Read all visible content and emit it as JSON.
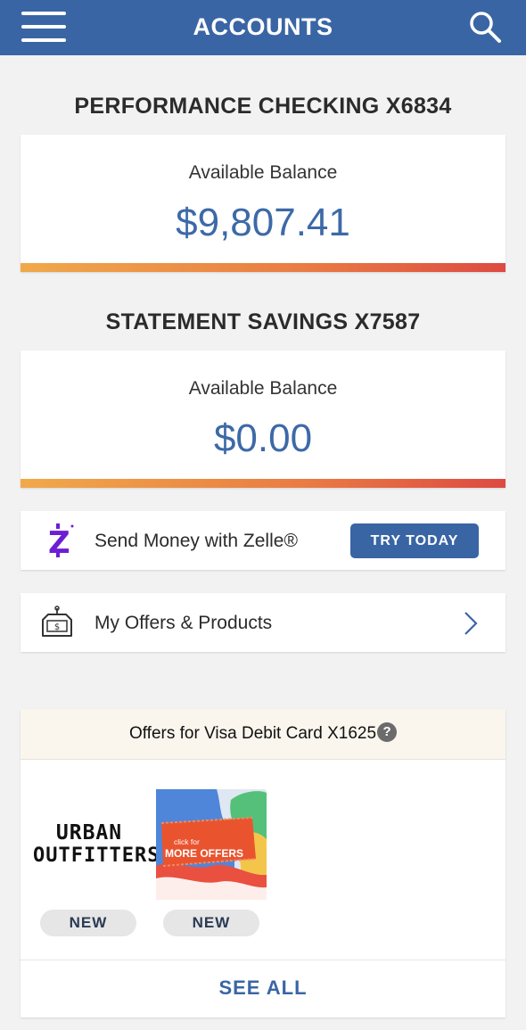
{
  "header": {
    "title": "ACCOUNTS",
    "menu_icon": "hamburger-menu-icon",
    "search_icon": "search-icon"
  },
  "accounts": [
    {
      "name": "PERFORMANCE CHECKING X6834",
      "balance_label": "Available Balance",
      "balance": "$9,807.41"
    },
    {
      "name": "STATEMENT SAVINGS X7587",
      "balance_label": "Available Balance",
      "balance": "$0.00"
    }
  ],
  "zelle": {
    "icon": "zelle-icon",
    "label": "Send Money with Zelle®",
    "button_label": "TRY TODAY"
  },
  "offers_products": {
    "icon": "price-tag-icon",
    "label": "My Offers & Products",
    "chevron_icon": "chevron-right-icon"
  },
  "card_offers": {
    "header": "Offers for Visa Debit Card X1625",
    "help_icon": "?",
    "items": [
      {
        "brand_line1": "URBAN",
        "brand_line2": "OUTFITTERS",
        "badge": "NEW"
      },
      {
        "promo_line1": "click for",
        "promo_line2": "MORE OFFERS",
        "badge": "NEW"
      }
    ],
    "see_all_label": "SEE ALL"
  },
  "colors": {
    "header_bg": "#3a65a5",
    "balance_text": "#3d69a8",
    "zelle_purple": "#6d1ed4",
    "gradient_start": "#f0a94a",
    "gradient_end": "#dd4a42"
  }
}
